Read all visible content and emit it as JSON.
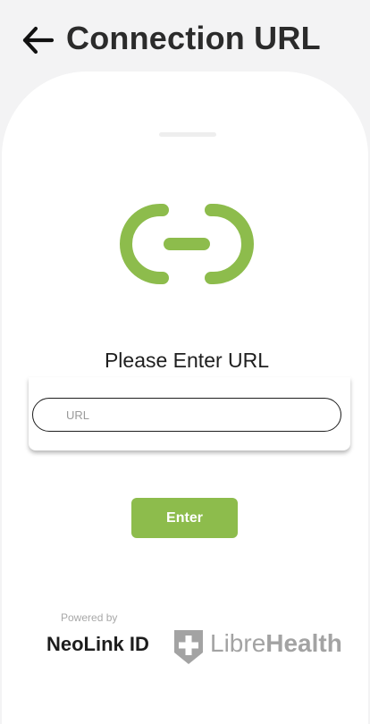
{
  "header": {
    "back_icon": "arrow-left-icon",
    "title": "Connection URL"
  },
  "main": {
    "link_icon": "link-icon",
    "prompt": "Please Enter URL",
    "url_input": {
      "value": "",
      "placeholder": "URL"
    },
    "enter_label": "Enter"
  },
  "footer": {
    "powered_by": "Powered by",
    "neolink_logo_text": "NeoLink ID",
    "librehealth_light": "Libre",
    "librehealth_bold": "Health",
    "librehealth_icon": "shield-plus-icon"
  },
  "colors": {
    "accent": "#8dbc4c",
    "title": "#2b2b2b",
    "header_bg": "#f3f3f4",
    "librehealth_gray": "#a3a3a3"
  }
}
